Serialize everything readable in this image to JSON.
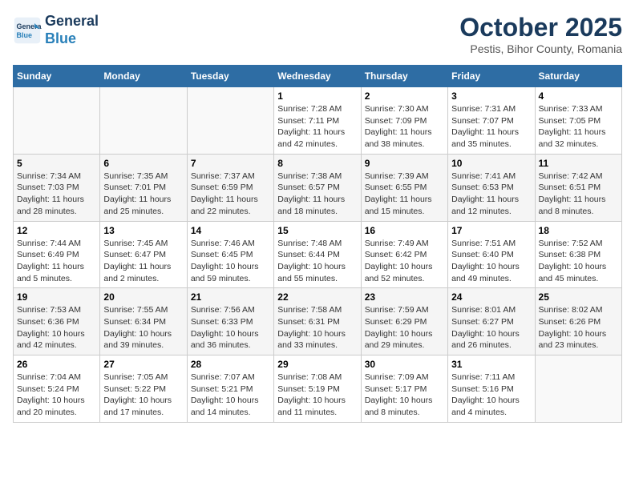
{
  "header": {
    "logo_line1": "General",
    "logo_line2": "Blue",
    "month": "October 2025",
    "location": "Pestis, Bihor County, Romania"
  },
  "weekdays": [
    "Sunday",
    "Monday",
    "Tuesday",
    "Wednesday",
    "Thursday",
    "Friday",
    "Saturday"
  ],
  "weeks": [
    [
      {
        "day": "",
        "info": ""
      },
      {
        "day": "",
        "info": ""
      },
      {
        "day": "",
        "info": ""
      },
      {
        "day": "1",
        "info": "Sunrise: 7:28 AM\nSunset: 7:11 PM\nDaylight: 11 hours and 42 minutes."
      },
      {
        "day": "2",
        "info": "Sunrise: 7:30 AM\nSunset: 7:09 PM\nDaylight: 11 hours and 38 minutes."
      },
      {
        "day": "3",
        "info": "Sunrise: 7:31 AM\nSunset: 7:07 PM\nDaylight: 11 hours and 35 minutes."
      },
      {
        "day": "4",
        "info": "Sunrise: 7:33 AM\nSunset: 7:05 PM\nDaylight: 11 hours and 32 minutes."
      }
    ],
    [
      {
        "day": "5",
        "info": "Sunrise: 7:34 AM\nSunset: 7:03 PM\nDaylight: 11 hours and 28 minutes."
      },
      {
        "day": "6",
        "info": "Sunrise: 7:35 AM\nSunset: 7:01 PM\nDaylight: 11 hours and 25 minutes."
      },
      {
        "day": "7",
        "info": "Sunrise: 7:37 AM\nSunset: 6:59 PM\nDaylight: 11 hours and 22 minutes."
      },
      {
        "day": "8",
        "info": "Sunrise: 7:38 AM\nSunset: 6:57 PM\nDaylight: 11 hours and 18 minutes."
      },
      {
        "day": "9",
        "info": "Sunrise: 7:39 AM\nSunset: 6:55 PM\nDaylight: 11 hours and 15 minutes."
      },
      {
        "day": "10",
        "info": "Sunrise: 7:41 AM\nSunset: 6:53 PM\nDaylight: 11 hours and 12 minutes."
      },
      {
        "day": "11",
        "info": "Sunrise: 7:42 AM\nSunset: 6:51 PM\nDaylight: 11 hours and 8 minutes."
      }
    ],
    [
      {
        "day": "12",
        "info": "Sunrise: 7:44 AM\nSunset: 6:49 PM\nDaylight: 11 hours and 5 minutes."
      },
      {
        "day": "13",
        "info": "Sunrise: 7:45 AM\nSunset: 6:47 PM\nDaylight: 11 hours and 2 minutes."
      },
      {
        "day": "14",
        "info": "Sunrise: 7:46 AM\nSunset: 6:45 PM\nDaylight: 10 hours and 59 minutes."
      },
      {
        "day": "15",
        "info": "Sunrise: 7:48 AM\nSunset: 6:44 PM\nDaylight: 10 hours and 55 minutes."
      },
      {
        "day": "16",
        "info": "Sunrise: 7:49 AM\nSunset: 6:42 PM\nDaylight: 10 hours and 52 minutes."
      },
      {
        "day": "17",
        "info": "Sunrise: 7:51 AM\nSunset: 6:40 PM\nDaylight: 10 hours and 49 minutes."
      },
      {
        "day": "18",
        "info": "Sunrise: 7:52 AM\nSunset: 6:38 PM\nDaylight: 10 hours and 45 minutes."
      }
    ],
    [
      {
        "day": "19",
        "info": "Sunrise: 7:53 AM\nSunset: 6:36 PM\nDaylight: 10 hours and 42 minutes."
      },
      {
        "day": "20",
        "info": "Sunrise: 7:55 AM\nSunset: 6:34 PM\nDaylight: 10 hours and 39 minutes."
      },
      {
        "day": "21",
        "info": "Sunrise: 7:56 AM\nSunset: 6:33 PM\nDaylight: 10 hours and 36 minutes."
      },
      {
        "day": "22",
        "info": "Sunrise: 7:58 AM\nSunset: 6:31 PM\nDaylight: 10 hours and 33 minutes."
      },
      {
        "day": "23",
        "info": "Sunrise: 7:59 AM\nSunset: 6:29 PM\nDaylight: 10 hours and 29 minutes."
      },
      {
        "day": "24",
        "info": "Sunrise: 8:01 AM\nSunset: 6:27 PM\nDaylight: 10 hours and 26 minutes."
      },
      {
        "day": "25",
        "info": "Sunrise: 8:02 AM\nSunset: 6:26 PM\nDaylight: 10 hours and 23 minutes."
      }
    ],
    [
      {
        "day": "26",
        "info": "Sunrise: 7:04 AM\nSunset: 5:24 PM\nDaylight: 10 hours and 20 minutes."
      },
      {
        "day": "27",
        "info": "Sunrise: 7:05 AM\nSunset: 5:22 PM\nDaylight: 10 hours and 17 minutes."
      },
      {
        "day": "28",
        "info": "Sunrise: 7:07 AM\nSunset: 5:21 PM\nDaylight: 10 hours and 14 minutes."
      },
      {
        "day": "29",
        "info": "Sunrise: 7:08 AM\nSunset: 5:19 PM\nDaylight: 10 hours and 11 minutes."
      },
      {
        "day": "30",
        "info": "Sunrise: 7:09 AM\nSunset: 5:17 PM\nDaylight: 10 hours and 8 minutes."
      },
      {
        "day": "31",
        "info": "Sunrise: 7:11 AM\nSunset: 5:16 PM\nDaylight: 10 hours and 4 minutes."
      },
      {
        "day": "",
        "info": ""
      }
    ]
  ]
}
